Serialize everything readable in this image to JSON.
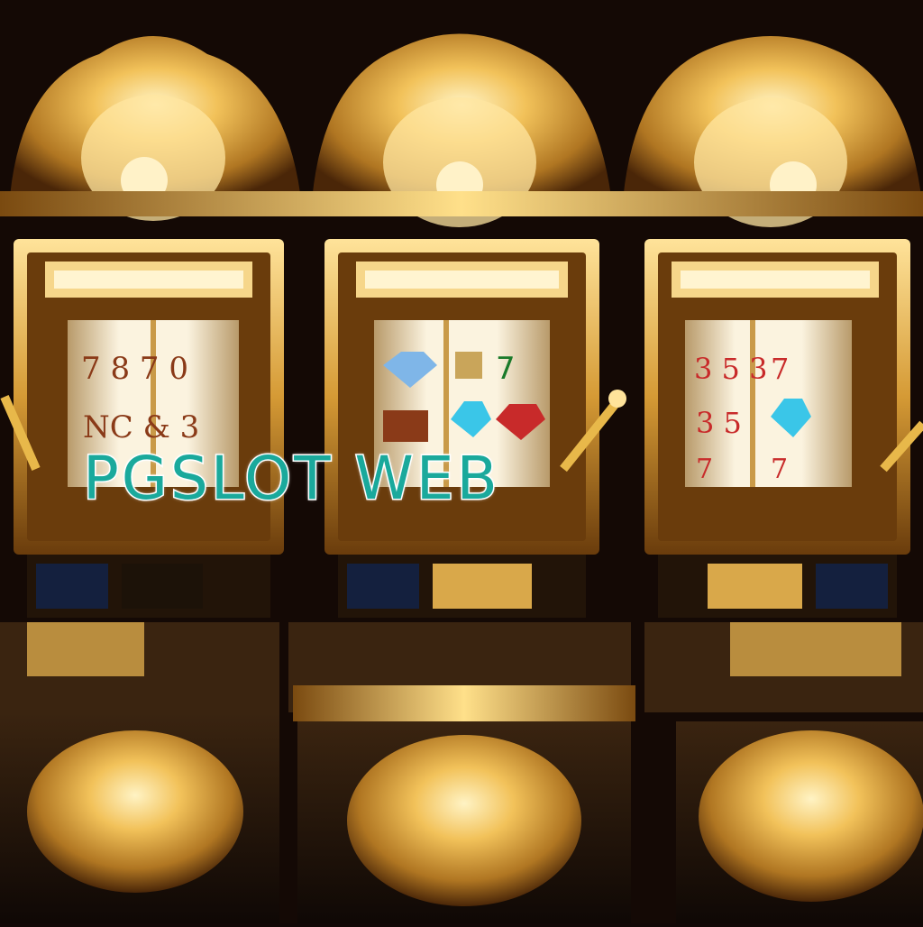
{
  "overlay": {
    "title": "PGSLOT WEB"
  },
  "colors": {
    "gold": "#e8b84a",
    "gold_dark": "#7a4a10",
    "navy": "#14203e",
    "teal_text": "#1aa99c"
  },
  "machines": [
    {
      "name": "left-slot-machine",
      "reels": [
        [
          "7",
          "8",
          "7"
        ],
        [
          "N",
          "C",
          "&",
          "3"
        ]
      ]
    },
    {
      "name": "center-slot-machine",
      "reels": [
        [
          "diamond",
          "bar",
          "bar"
        ],
        [
          "7",
          "diamond",
          "diamond"
        ]
      ]
    },
    {
      "name": "right-slot-machine",
      "reels": [
        [
          "3",
          "5",
          "3"
        ],
        [
          "7",
          "7",
          "7"
        ]
      ]
    }
  ]
}
